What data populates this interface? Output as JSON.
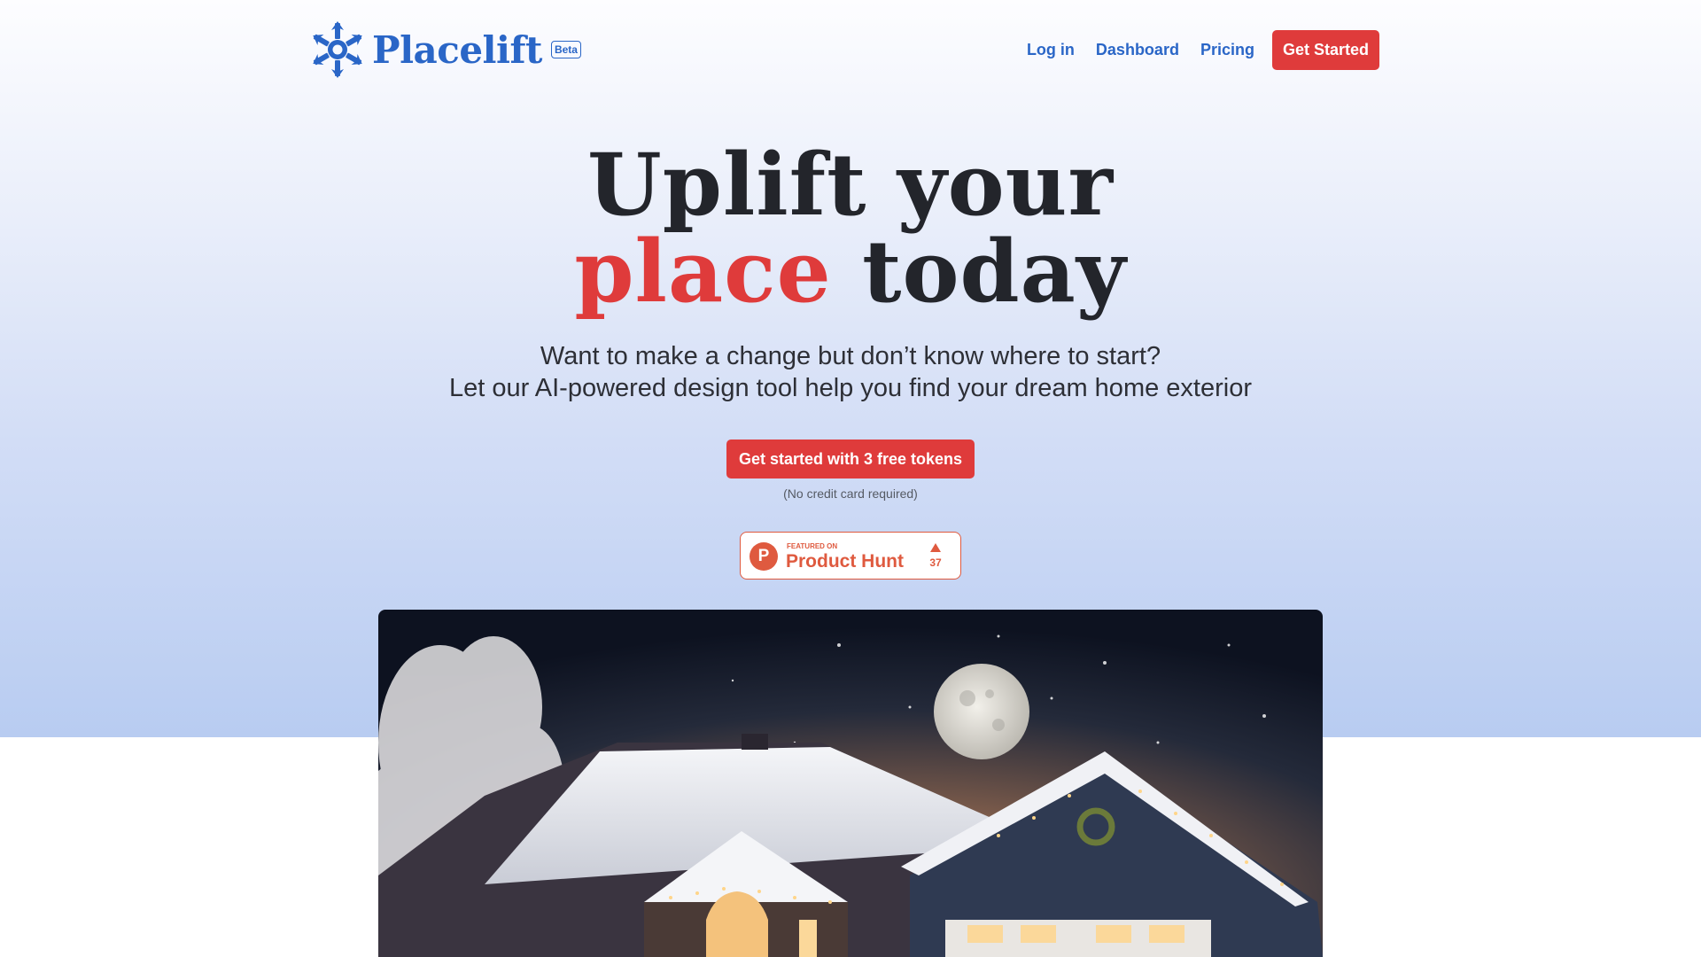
{
  "brand": {
    "name": "Placelift",
    "badge": "Beta",
    "logo_icon": "snowflake-icon",
    "accent_color": "#2a66c7",
    "cta_color": "#df3b3b"
  },
  "nav": {
    "login": "Log in",
    "dashboard": "Dashboard",
    "pricing": "Pricing",
    "get_started": "Get Started"
  },
  "hero": {
    "headline_line1": "Uplift your",
    "headline_accent": "place",
    "headline_rest": "today",
    "subtitle_line1": "Want to make a change but don’t know where to start?",
    "subtitle_line2": "Let our AI-powered design tool help you find your dream home exterior",
    "cta_label": "Get started with 3 free tokens",
    "cta_note": "(No credit card required)"
  },
  "product_hunt": {
    "featured_label": "FEATURED ON",
    "name": "Product Hunt",
    "logo_letter": "P",
    "upvotes": "37",
    "color": "#df5a3f"
  },
  "hero_image": {
    "icon": "house-night-snow-image"
  }
}
